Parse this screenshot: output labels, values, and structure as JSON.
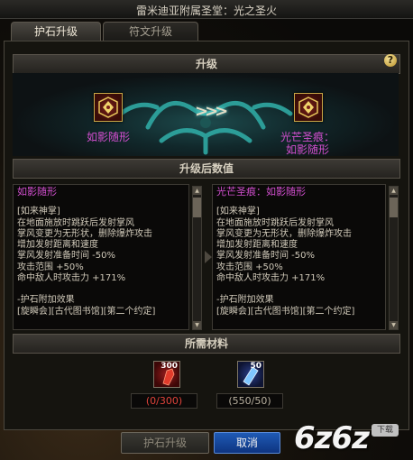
{
  "window": {
    "title": "雷米迪亚附属圣堂：光之圣火"
  },
  "tabs": [
    {
      "label": "护石升级",
      "active": true
    },
    {
      "label": "符文升级",
      "active": false
    }
  ],
  "upgrade": {
    "header": "升级",
    "help_label": "?",
    "arrow_text": ">>>",
    "from_item": {
      "name": "如影随形",
      "icon": "talisman-icon"
    },
    "to_item": {
      "name_line1": "光芒圣痕：",
      "name_line2": "如影随形",
      "icon": "talisman-icon"
    }
  },
  "stats": {
    "header": "升级后数值",
    "left": {
      "title": "如影随形",
      "lines": [
        "[如来神掌]",
        "在地面施放时跳跃后发射掌风",
        "掌风变更为无形状，删除爆炸攻击",
        "增加发射距离和速度",
        "掌风发射准备时间 -50%",
        "攻击范围 +50%",
        "命中敌人时攻击力 +171%",
        "",
        "-护石附加效果",
        "[旋瞬会][古代图书馆][第二个约定]"
      ]
    },
    "right": {
      "title": "光芒圣痕：如影随形",
      "lines": [
        "[如来神掌]",
        "在地面施放时跳跃后发射掌风",
        "掌风变更为无形状，删除爆炸攻击",
        "增加发射距离和速度",
        "掌风发射准备时间 -50%",
        "攻击范围 +50%",
        "命中敌人时攻击力 +171%",
        "",
        "-护石附加效果",
        "[旋瞬会][古代图书馆][第二个约定]"
      ]
    }
  },
  "materials": {
    "header": "所需材料",
    "items": [
      {
        "count": "300",
        "qty": "(0/300)",
        "icon": "red-crystal-icon",
        "sufficient": false
      },
      {
        "count": "50",
        "qty": "(550/50)",
        "icon": "blue-crystal-icon",
        "sufficient": true
      }
    ]
  },
  "buttons": {
    "upgrade": "护石升级",
    "cancel": "取消"
  },
  "watermark": {
    "text": "6z6z",
    "badge": "下载"
  },
  "colors": {
    "item_name": "#d24fcf",
    "lack": "#e0433a",
    "accent_button": "#1f5ab5"
  }
}
